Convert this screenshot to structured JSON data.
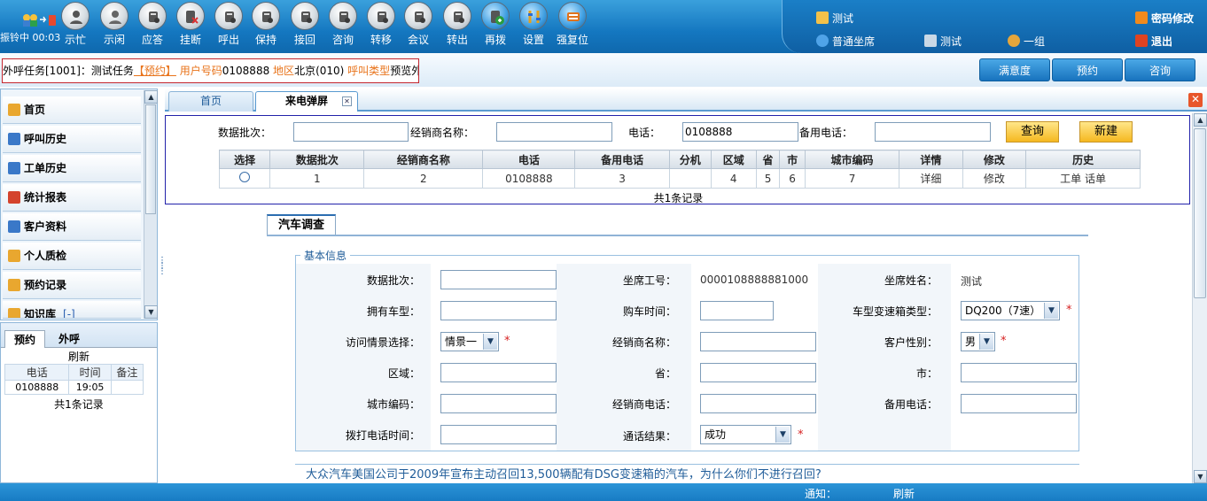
{
  "status": {
    "text": "振铃中 00:03"
  },
  "toolbar": [
    {
      "label": "示忙",
      "icon": "busy-icon"
    },
    {
      "label": "示闲",
      "icon": "idle-icon"
    },
    {
      "label": "应答",
      "icon": "answer-icon"
    },
    {
      "label": "挂断",
      "icon": "hangup-icon"
    },
    {
      "label": "呼出",
      "icon": "callout-icon"
    },
    {
      "label": "保持",
      "icon": "hold-icon"
    },
    {
      "label": "接回",
      "icon": "retrieve-icon"
    },
    {
      "label": "咨询",
      "icon": "consult-icon"
    },
    {
      "label": "转移",
      "icon": "transfer-icon"
    },
    {
      "label": "会议",
      "icon": "conference-icon"
    },
    {
      "label": "转出",
      "icon": "transfer-out-icon"
    },
    {
      "label": "再拨",
      "icon": "redial-icon"
    },
    {
      "label": "设置",
      "icon": "settings-icon"
    },
    {
      "label": "强复位",
      "icon": "reset-icon"
    }
  ],
  "user_panel": {
    "user_name": "测试",
    "password_change": "密码修改",
    "agent_type": "普通坐席",
    "group_test": "测试",
    "group_one": "一组",
    "logout": "退出"
  },
  "task": {
    "prefix": "外呼任务[1001]：测试任务",
    "appointment": "【预约】",
    "user_number_label": "用户号码",
    "user_number": "0108888",
    "region_label": "地区",
    "region": "北京(010)",
    "call_type_label": "呼叫类型",
    "call_type": "预览外呼"
  },
  "right_buttons": {
    "satisfaction": "满意度",
    "appointment": "预约",
    "consult": "咨询"
  },
  "nav": [
    {
      "label": "首页",
      "icon": "home-icon"
    },
    {
      "label": "呼叫历史",
      "icon": "phone-icon"
    },
    {
      "label": "工单历史",
      "icon": "ticket-icon"
    },
    {
      "label": "统计报表",
      "icon": "chart-icon"
    },
    {
      "label": "客户资料",
      "icon": "customer-icon"
    },
    {
      "label": "个人质检",
      "icon": "person-icon"
    },
    {
      "label": "预约记录",
      "icon": "appointment-icon"
    },
    {
      "label": "知识库",
      "icon": "knowledge-icon",
      "extra": "[-]"
    }
  ],
  "left_bottom": {
    "tab_appointment": "预约",
    "tab_outbound": "外呼",
    "refresh": "刷新",
    "columns": [
      "电话",
      "时间",
      "备注"
    ],
    "rows": [
      [
        "0108888",
        "19:05",
        ""
      ]
    ],
    "total": "共1条记录"
  },
  "tabs": {
    "home": "首页",
    "popup": "来电弹屏"
  },
  "search": {
    "batch_label": "数据批次：",
    "batch_value": "",
    "dealer_label": "经销商名称：",
    "dealer_value": "",
    "phone_label": "电话：",
    "phone_value": "0108888",
    "backup_label": "备用电话：",
    "backup_value": "",
    "query_button": "查询",
    "new_button": "新建"
  },
  "results": {
    "columns": [
      "选择",
      "数据批次",
      "经销商名称",
      "电话",
      "备用电话",
      "分机",
      "区域",
      "省",
      "市",
      "城市编码",
      "详情",
      "修改",
      "历史"
    ],
    "rows": [
      [
        "",
        "1",
        "2",
        "0108888",
        "3",
        "",
        "4",
        "5",
        "6",
        "7",
        "详细",
        "修改",
        "工单 话单"
      ]
    ],
    "total": "共1条记录"
  },
  "survey": {
    "tab": "汽车调查",
    "legend": "基本信息",
    "batch_label": "数据批次：",
    "agent_no_label": "坐席工号：",
    "agent_no": "0000108888881000",
    "agent_name_label": "坐席姓名：",
    "agent_name": "测试",
    "car_model_label": "拥有车型：",
    "purchase_time_label": "购车时间：",
    "gearbox_label": "车型变速箱类型：",
    "gearbox_value": "DQ200（7速）",
    "scene_label": "访问情景选择：",
    "scene_value": "情景一",
    "dealer_name_label": "经销商名称：",
    "gender_label": "客户性别：",
    "gender_value": "男",
    "area_label": "区域：",
    "province_label": "省：",
    "city_label": "市：",
    "city_code_label": "城市编码：",
    "dealer_phone_label": "经销商电话：",
    "backup_phone_label": "备用电话：",
    "call_time_label": "拨打电话时间：",
    "call_result_label": "通话结果：",
    "call_result_value": "成功",
    "question": "大众汽车美国公司于2009年宣布主动召回13,500辆配有DSG变速箱的汽车，为什么你们不进行召回?"
  },
  "bottom": {
    "notice_label": "通知：",
    "refresh": "刷新"
  }
}
